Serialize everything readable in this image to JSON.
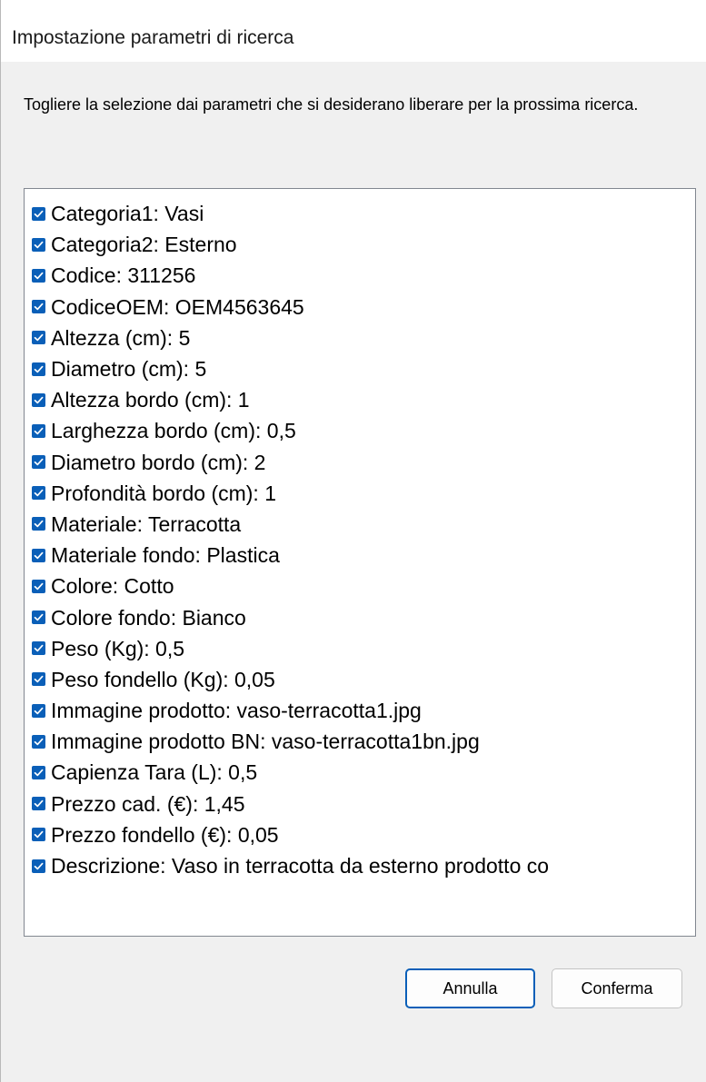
{
  "window": {
    "title": "Impostazione parametri di ricerca"
  },
  "instruction": "Togliere la selezione dai parametri che si desiderano liberare per la prossima ricerca.",
  "parameters": [
    {
      "label": "Categoria1: Vasi",
      "checked": true
    },
    {
      "label": "Categoria2: Esterno",
      "checked": true
    },
    {
      "label": "Codice: 311256",
      "checked": true
    },
    {
      "label": "CodiceOEM: OEM4563645",
      "checked": true
    },
    {
      "label": "Altezza (cm): 5",
      "checked": true
    },
    {
      "label": "Diametro (cm): 5",
      "checked": true
    },
    {
      "label": "Altezza bordo (cm): 1",
      "checked": true
    },
    {
      "label": "Larghezza bordo (cm): 0,5",
      "checked": true
    },
    {
      "label": "Diametro bordo (cm): 2",
      "checked": true
    },
    {
      "label": "Profondità bordo (cm): 1",
      "checked": true
    },
    {
      "label": "Materiale: Terracotta",
      "checked": true
    },
    {
      "label": "Materiale fondo: Plastica",
      "checked": true
    },
    {
      "label": "Colore: Cotto",
      "checked": true
    },
    {
      "label": "Colore fondo: Bianco",
      "checked": true
    },
    {
      "label": "Peso (Kg): 0,5",
      "checked": true
    },
    {
      "label": "Peso fondello (Kg): 0,05",
      "checked": true
    },
    {
      "label": "Immagine prodotto: vaso-terracotta1.jpg",
      "checked": true
    },
    {
      "label": "Immagine prodotto BN: vaso-terracotta1bn.jpg",
      "checked": true
    },
    {
      "label": "Capienza Tara (L): 0,5",
      "checked": true
    },
    {
      "label": "Prezzo cad. (€): 1,45",
      "checked": true
    },
    {
      "label": "Prezzo fondello (€): 0,05",
      "checked": true
    },
    {
      "label": "Descrizione: Vaso in terracotta da esterno prodotto co",
      "checked": true
    }
  ],
  "buttons": {
    "cancel_label": "Annulla",
    "confirm_label": "Conferma"
  },
  "colors": {
    "checkbox_fill": "#0a5fb8",
    "focus_border": "#0a5fb8"
  },
  "icons": {
    "checkbox": "checkmark-icon"
  }
}
